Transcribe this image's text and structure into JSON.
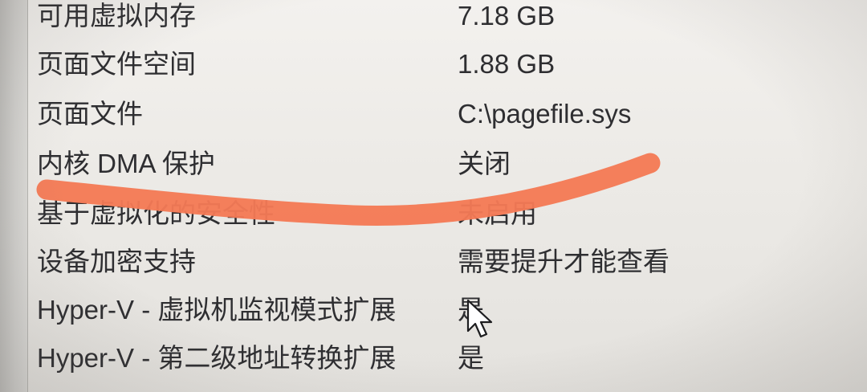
{
  "rows": [
    {
      "label": "可用虚拟内存",
      "value": "7.18 GB"
    },
    {
      "label": "页面文件空间",
      "value": "1.88 GB"
    },
    {
      "label": "页面文件",
      "value": "C:\\pagefile.sys"
    },
    {
      "label": "内核 DMA 保护",
      "value": "关闭"
    },
    {
      "label": "基于虚拟化的安全性",
      "value": "未启用"
    },
    {
      "label": "设备加密支持",
      "value": "需要提升才能查看"
    },
    {
      "label": "Hyper-V - 虚拟机监视模式扩展",
      "value": "是"
    },
    {
      "label": "Hyper-V - 第二级地址转换扩展",
      "value": "是"
    }
  ],
  "colors": {
    "redaction_stroke": "#f47a55",
    "text": "#2e2e31",
    "background": "#eceae6"
  },
  "icons": {
    "cursor": "mouse-pointer-icon"
  }
}
